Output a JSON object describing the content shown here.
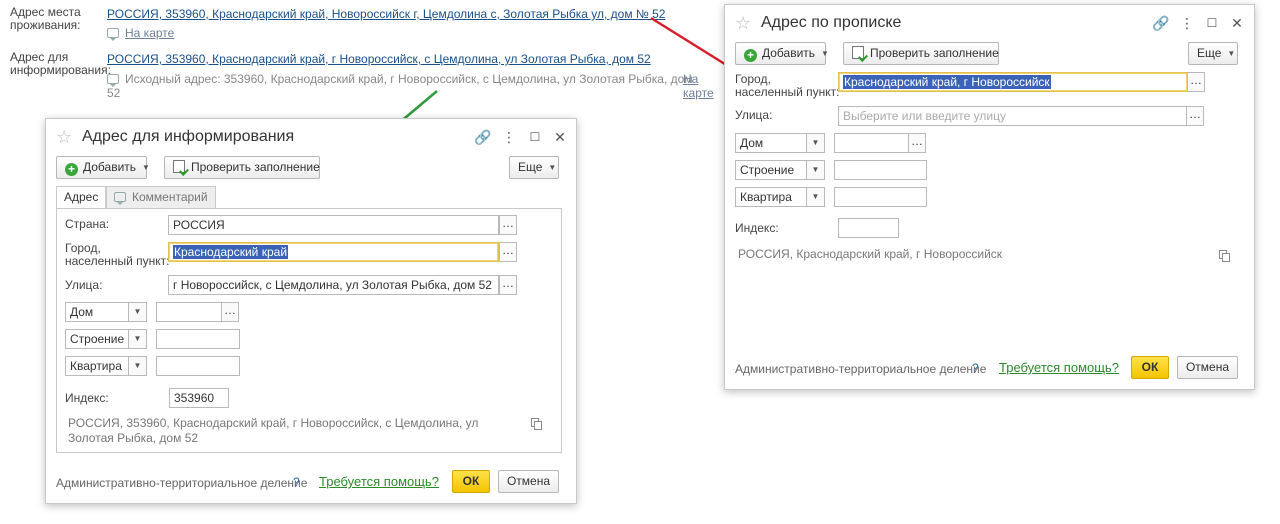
{
  "background_form": {
    "residence_label": "Адрес места проживания:",
    "residence_address": "РОССИЯ, 353960, Краснодарский край, Новороссийск г, Цемдолина с, Золотая Рыбка ул, дом № 52",
    "residence_map_link": "На карте",
    "info_label": "Адрес для информирования:",
    "info_address": "РОССИЯ, 353960, Краснодарский край, г Новороссийск, с Цемдолина, ул Золотая Рыбка, дом 52",
    "info_source": "Исходный адрес: 353960, Краснодарский край, г Новороссийск, с Цемдолина, ул Золотая Рыбка, дом 52",
    "info_map_link_1": "На",
    "info_map_link_2": "карте"
  },
  "dialog_info": {
    "title": "Адрес для информирования",
    "add_label": "Добавить",
    "check_label": "Проверить заполнение",
    "more_label": "Еще",
    "tabs": [
      {
        "label": "Адрес"
      },
      {
        "label": "Комментарий"
      }
    ],
    "country_label": "Страна:",
    "country_value": "РОССИЯ",
    "city_label": "Город, населенный пункт:",
    "city_value": "Краснодарский край",
    "street_label": "Улица:",
    "street_value": "г Новороссийск, с Цемдолина, ул Золотая Рыбка, дом 52",
    "house_type": "Дом",
    "building_type": "Строение",
    "apartment_type": "Квартира",
    "index_label": "Индекс:",
    "index_value": "353960",
    "summary": "РОССИЯ, 353960, Краснодарский край, г Новороссийск, с Цемдолина, ул Золотая Рыбка, дом 52",
    "admin_label": "Административно-территориальное деление",
    "admin_q": "?",
    "help_link": "Требуется помощь?",
    "ok_label": "ОК",
    "cancel_label": "Отмена"
  },
  "dialog_reg": {
    "title": "Адрес по прописке",
    "add_label": "Добавить",
    "check_label": "Проверить заполнение",
    "more_label": "Еще",
    "city_label": "Город, населенный пункт:",
    "city_value": "Краснодарский край, г Новороссийск",
    "street_label": "Улица:",
    "street_placeholder": "Выберите или введите улицу",
    "house_type": "Дом",
    "building_type": "Строение",
    "apartment_type": "Квартира",
    "index_label": "Индекс:",
    "summary": "РОССИЯ, Краснодарский край, г Новороссийск",
    "admin_label": "Административно-территориальное деление",
    "admin_q": "?",
    "help_link": "Требуется помощь?",
    "ok_label": "ОК",
    "cancel_label": "Отмена"
  },
  "icons": {
    "star": "star-icon",
    "link": "link-icon",
    "menu": "more-vertical-icon",
    "maximize": "maximize-icon",
    "close": "close-icon",
    "plus": "plus-circle-icon",
    "check": "check-fill-icon",
    "copy": "copy-icon",
    "comment": "comment-icon"
  },
  "colors": {
    "link": "#1a4f8a",
    "ok_button": "#f4c400",
    "help_link": "#2a8a2a",
    "selection": "#3a63b8",
    "red_arrow": "#d81e2c",
    "green_arrow": "#2e9a3a"
  }
}
